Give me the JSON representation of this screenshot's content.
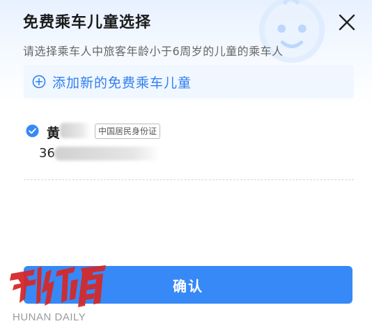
{
  "dialog": {
    "title": "免费乘车儿童选择",
    "subtitle": "请选择乘车人中旅客年龄小于6周岁的儿童的乘车人",
    "add_child_label": "添加新的免费乘车儿童",
    "close_icon": "close-icon",
    "add_icon": "plus-circle-icon",
    "decoration_icon": "baby-face-icon"
  },
  "passengers": [
    {
      "name_visible": "黄",
      "id_type_tag": "中国居民身份证",
      "id_number_visible": "36",
      "selected": true,
      "check_icon": "check-circle-icon"
    }
  ],
  "footer": {
    "confirm_label": "确认"
  },
  "watermark": {
    "text": "HUNAN DAILY",
    "logo_chars": "新湖南"
  },
  "colors": {
    "accent": "#3689f7",
    "link": "#2f7ff0",
    "add_row_bg": "#f1f7ff",
    "header_gradient": "#e7f1ff",
    "watermark_logo": "#d42a2a"
  }
}
